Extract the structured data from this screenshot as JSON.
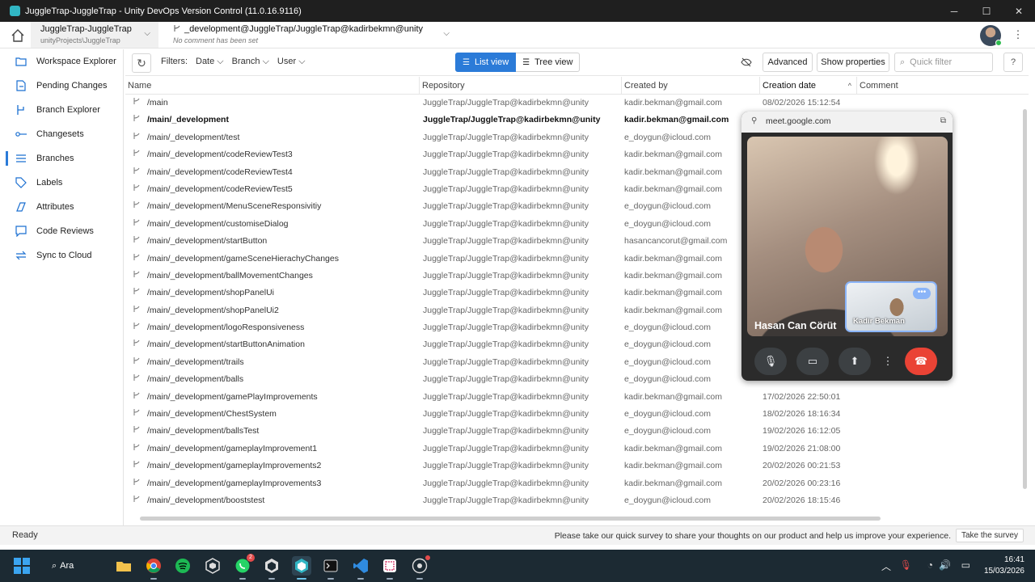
{
  "window": {
    "title": "JuggleTrap-JuggleTrap - Unity DevOps Version Control (11.0.16.9116)"
  },
  "workspace": {
    "name": "JuggleTrap-JuggleTrap",
    "path": "unityProjects\\JuggleTrap"
  },
  "branch_selector": {
    "name": "_development@JuggleTrap/JuggleTrap@kadirbekmn@unity",
    "comment": "No comment has been set"
  },
  "sidebar": {
    "items": [
      {
        "label": "Workspace Explorer",
        "icon": "folder-icon"
      },
      {
        "label": "Pending Changes",
        "icon": "pending-icon"
      },
      {
        "label": "Branch Explorer",
        "icon": "branch-explorer-icon"
      },
      {
        "label": "Changesets",
        "icon": "changeset-icon"
      },
      {
        "label": "Branches",
        "icon": "list-icon"
      },
      {
        "label": "Labels",
        "icon": "tag-icon"
      },
      {
        "label": "Attributes",
        "icon": "attribute-icon"
      },
      {
        "label": "Code Reviews",
        "icon": "code-review-icon"
      },
      {
        "label": "Sync to Cloud",
        "icon": "sync-icon"
      }
    ],
    "active": "Branches"
  },
  "toolbar": {
    "filters_label": "Filters:",
    "filter_date": "Date",
    "filter_branch": "Branch",
    "filter_user": "User",
    "list_view": "List view",
    "tree_view": "Tree view",
    "advanced": "Advanced",
    "show_properties": "Show properties",
    "quick_filter_placeholder": "Quick filter",
    "help": "?"
  },
  "table": {
    "columns": [
      "Name",
      "Repository",
      "Created by",
      "Creation date",
      "Comment"
    ],
    "rows": [
      {
        "name": "/main",
        "repo": "JuggleTrap/JuggleTrap@kadirbekmn@unity",
        "by": "kadir.bekman@gmail.com",
        "date": "08/02/2026 15:12:54"
      },
      {
        "name": "/main/_development",
        "repo": "JuggleTrap/JuggleTrap@kadirbekmn@unity",
        "by": "kadir.bekman@gmail.com",
        "date": ""
      },
      {
        "name": "/main/_development/test",
        "repo": "JuggleTrap/JuggleTrap@kadirbekmn@unity",
        "by": "e_doygun@icloud.com",
        "date": ""
      },
      {
        "name": "/main/_development/codeReviewTest3",
        "repo": "JuggleTrap/JuggleTrap@kadirbekmn@unity",
        "by": "kadir.bekman@gmail.com",
        "date": ""
      },
      {
        "name": "/main/_development/codeReviewTest4",
        "repo": "JuggleTrap/JuggleTrap@kadirbekmn@unity",
        "by": "kadir.bekman@gmail.com",
        "date": ""
      },
      {
        "name": "/main/_development/codeReviewTest5",
        "repo": "JuggleTrap/JuggleTrap@kadirbekmn@unity",
        "by": "kadir.bekman@gmail.com",
        "date": ""
      },
      {
        "name": "/main/_development/MenuSceneResponsivitiy",
        "repo": "JuggleTrap/JuggleTrap@kadirbekmn@unity",
        "by": "e_doygun@icloud.com",
        "date": ""
      },
      {
        "name": "/main/_development/customiseDialog",
        "repo": "JuggleTrap/JuggleTrap@kadirbekmn@unity",
        "by": "e_doygun@icloud.com",
        "date": ""
      },
      {
        "name": "/main/_development/startButton",
        "repo": "JuggleTrap/JuggleTrap@kadirbekmn@unity",
        "by": "hasancancorut@gmail.com",
        "date": ""
      },
      {
        "name": "/main/_development/gameSceneHierachyChanges",
        "repo": "JuggleTrap/JuggleTrap@kadirbekmn@unity",
        "by": "kadir.bekman@gmail.com",
        "date": ""
      },
      {
        "name": "/main/_development/ballMovementChanges",
        "repo": "JuggleTrap/JuggleTrap@kadirbekmn@unity",
        "by": "kadir.bekman@gmail.com",
        "date": ""
      },
      {
        "name": "/main/_development/shopPanelUi",
        "repo": "JuggleTrap/JuggleTrap@kadirbekmn@unity",
        "by": "kadir.bekman@gmail.com",
        "date": ""
      },
      {
        "name": "/main/_development/shopPanelUi2",
        "repo": "JuggleTrap/JuggleTrap@kadirbekmn@unity",
        "by": "kadir.bekman@gmail.com",
        "date": ""
      },
      {
        "name": "/main/_development/logoResponsiveness",
        "repo": "JuggleTrap/JuggleTrap@kadirbekmn@unity",
        "by": "e_doygun@icloud.com",
        "date": ""
      },
      {
        "name": "/main/_development/startButtonAnimation",
        "repo": "JuggleTrap/JuggleTrap@kadirbekmn@unity",
        "by": "e_doygun@icloud.com",
        "date": ""
      },
      {
        "name": "/main/_development/trails",
        "repo": "JuggleTrap/JuggleTrap@kadirbekmn@unity",
        "by": "e_doygun@icloud.com",
        "date": ""
      },
      {
        "name": "/main/_development/balls",
        "repo": "JuggleTrap/JuggleTrap@kadirbekmn@unity",
        "by": "e_doygun@icloud.com",
        "date": ""
      },
      {
        "name": "/main/_development/gamePlayImprovements",
        "repo": "JuggleTrap/JuggleTrap@kadirbekmn@unity",
        "by": "kadir.bekman@gmail.com",
        "date": "17/02/2026 22:50:01"
      },
      {
        "name": "/main/_development/ChestSystem",
        "repo": "JuggleTrap/JuggleTrap@kadirbekmn@unity",
        "by": "e_doygun@icloud.com",
        "date": "18/02/2026 18:16:34"
      },
      {
        "name": "/main/_development/ballsTest",
        "repo": "JuggleTrap/JuggleTrap@kadirbekmn@unity",
        "by": "e_doygun@icloud.com",
        "date": "19/02/2026 16:12:05"
      },
      {
        "name": "/main/_development/gameplayImprovement1",
        "repo": "JuggleTrap/JuggleTrap@kadirbekmn@unity",
        "by": "kadir.bekman@gmail.com",
        "date": "19/02/2026 21:08:00"
      },
      {
        "name": "/main/_development/gameplayImprovements2",
        "repo": "JuggleTrap/JuggleTrap@kadirbekmn@unity",
        "by": "kadir.bekman@gmail.com",
        "date": "20/02/2026 00:21:53"
      },
      {
        "name": "/main/_development/gameplayImprovements3",
        "repo": "JuggleTrap/JuggleTrap@kadirbekmn@unity",
        "by": "kadir.bekman@gmail.com",
        "date": "20/02/2026 00:23:16"
      },
      {
        "name": "/main/_development/booststest",
        "repo": "JuggleTrap/JuggleTrap@kadirbekmn@unity",
        "by": "e_doygun@icloud.com",
        "date": "20/02/2026 18:15:46"
      }
    ],
    "selected_index": 1
  },
  "status": {
    "ready": "Ready",
    "survey": "Please take our quick survey to share your thoughts on our product and help us improve your experience.",
    "take_survey": "Take the survey"
  },
  "meet": {
    "url": "meet.google.com",
    "participant_main": "Hasan Can Cörüt",
    "participant_self": "Kadir Bekman"
  },
  "taskbar": {
    "search_label": "Ara",
    "time": "16:41",
    "date": "15/03/2026",
    "whatsapp_badge": "2"
  },
  "colors": {
    "accent": "#2b7bd8",
    "taskbar": "#1c2a33",
    "end_call": "#ea4335"
  }
}
